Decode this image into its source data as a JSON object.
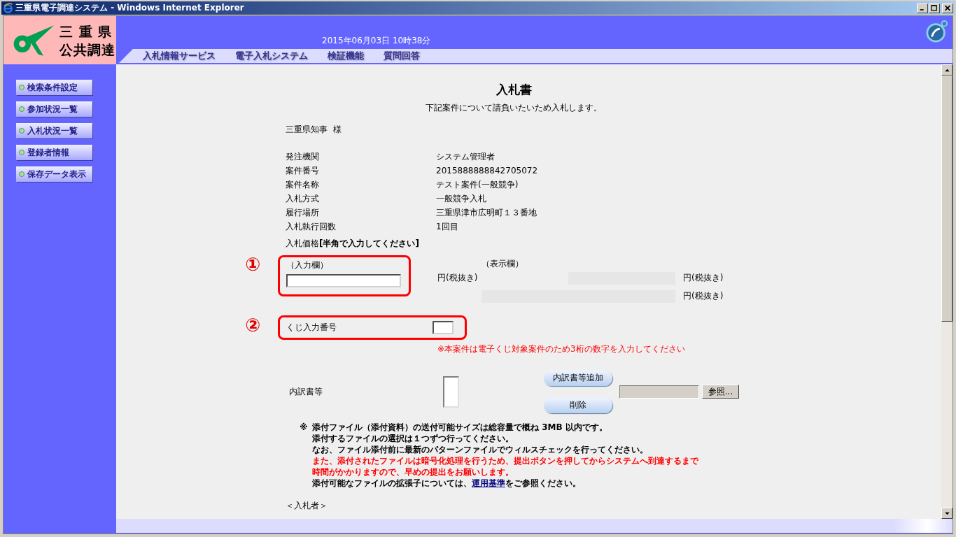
{
  "window": {
    "title": "三重県電子調達システム - Windows Internet Explorer"
  },
  "header": {
    "logo_lines": [
      "三 重 県",
      "公共調達"
    ],
    "datetime": "2015年06月03日 10時38分",
    "nav": [
      {
        "label": "入札情報サービス"
      },
      {
        "label": "電子入札システム"
      },
      {
        "label": "検証機能"
      },
      {
        "label": "質問回答"
      }
    ]
  },
  "sidebar": {
    "items": [
      {
        "label": "検索条件設定"
      },
      {
        "label": "参加状況一覧"
      },
      {
        "label": "入札状況一覧"
      },
      {
        "label": "登録者情報"
      },
      {
        "label": "保存データ表示"
      }
    ]
  },
  "form": {
    "title": "入札書",
    "intro": "下記案件について請負いたいため入札します。",
    "addressee": "三重県知事  様",
    "details": [
      {
        "label": "発注機関",
        "value": "システム管理者"
      },
      {
        "label": "案件番号",
        "value": "2015888888842705072"
      },
      {
        "label": "案件名称",
        "value": "テスト案件(一般競争)"
      },
      {
        "label": "入札方式",
        "value": "一般競争入札"
      },
      {
        "label": "履行場所",
        "value": "三重県津市広明町１３番地"
      },
      {
        "label": "入札執行回数",
        "value": "1回目"
      }
    ],
    "price": {
      "heading": "入札価格**[半角で入力してください]**",
      "marker": "①",
      "input_label": "（入力欄）",
      "display_label": "（表示欄）",
      "unit_input": "円(税抜き)",
      "unit_display": "円(税抜き)",
      "unit_display_2": "円(税抜き)"
    },
    "lottery": {
      "marker": "②",
      "label": "くじ入力番号",
      "note": "※本案件は電子くじ対象案件のため3桁の数字を入力してください"
    },
    "attachments": {
      "label": "内訳書等",
      "add_button": "内訳書等追加",
      "delete_button": "削除",
      "browse_button": "参照..."
    },
    "notes": {
      "mark": "※",
      "lines": [
        {
          "kind": "normal",
          "text": "添付ファイル（添付資料）の送付可能サイズは総容量で概ね 3MB 以内です。"
        },
        {
          "kind": "normal",
          "text": "添付するファイルの選択は１つずつ行ってください。"
        },
        {
          "kind": "normal",
          "text": "なお、ファイル添付前に最新のパターンファイルでウィルスチェックを行ってください。"
        },
        {
          "kind": "warning",
          "text": "また、添付されたファイルは暗号化処理を行うため、提出ボタンを押してからシステムへ到達するまで"
        },
        {
          "kind": "warning",
          "text": "時間がかかりますので、早めの提出をお願いします。"
        }
      ],
      "link_line": {
        "before": "添付可能なファイルの拡張子については、",
        "link": "運用基準",
        "after": "をご参照ください。"
      }
    },
    "section_heading": "＜入札者＞"
  }
}
